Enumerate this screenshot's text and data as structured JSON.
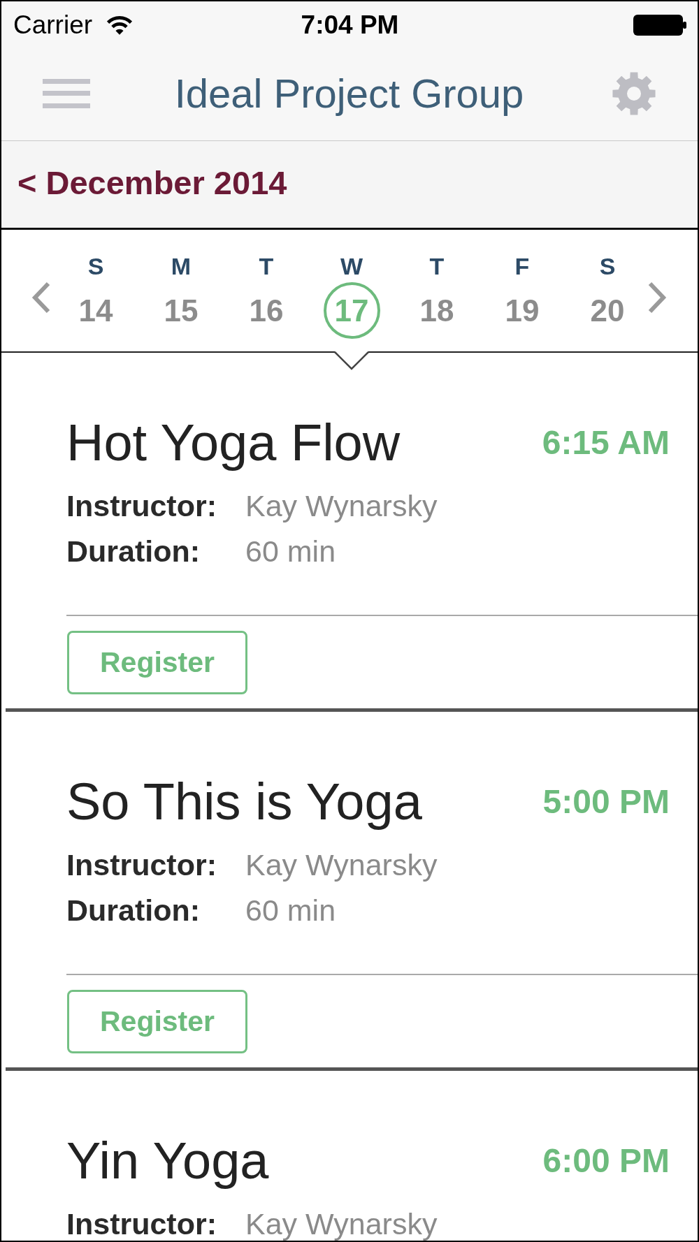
{
  "status_bar": {
    "carrier": "Carrier",
    "time": "7:04 PM"
  },
  "nav_bar": {
    "title": "Ideal Project Group"
  },
  "month_header": {
    "label": "< December 2014"
  },
  "week": {
    "days": [
      {
        "weekday": "S",
        "date": "14",
        "selected": false
      },
      {
        "weekday": "M",
        "date": "15",
        "selected": false
      },
      {
        "weekday": "T",
        "date": "16",
        "selected": false
      },
      {
        "weekday": "W",
        "date": "17",
        "selected": true
      },
      {
        "weekday": "T",
        "date": "18",
        "selected": false
      },
      {
        "weekday": "F",
        "date": "19",
        "selected": false
      },
      {
        "weekday": "S",
        "date": "20",
        "selected": false
      }
    ]
  },
  "classes": [
    {
      "name": "Hot Yoga Flow",
      "time": "6:15 AM",
      "details": [
        {
          "label": "Instructor:",
          "value": "Kay Wynarsky"
        },
        {
          "label": "Duration:",
          "value": "60 min"
        }
      ],
      "button": "Register"
    },
    {
      "name": "So This is Yoga",
      "time": "5:00 PM",
      "details": [
        {
          "label": "Instructor:",
          "value": "Kay Wynarsky"
        },
        {
          "label": "Duration:",
          "value": "60 min"
        }
      ],
      "button": "Register"
    },
    {
      "name": "Yin Yoga",
      "time": "6:00 PM",
      "details": [
        {
          "label": "Instructor:",
          "value": "Kay Wynarsky"
        }
      ]
    }
  ]
}
